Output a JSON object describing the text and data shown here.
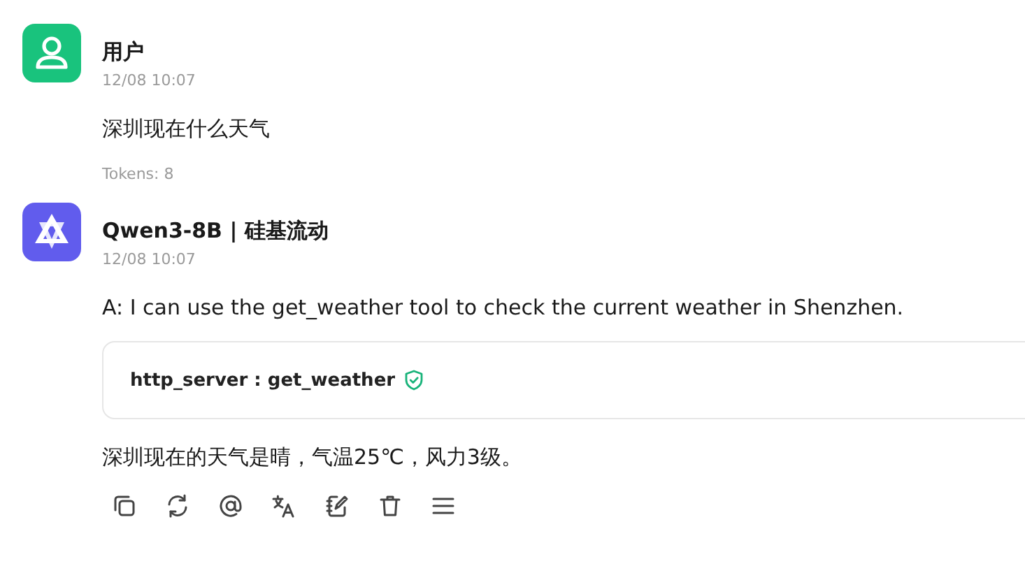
{
  "messages": [
    {
      "kind": "user",
      "name": "用户",
      "time": "12/08 10:07",
      "blocks": [
        {
          "kind": "text",
          "text": "深圳现在什么天气"
        }
      ],
      "tokens": "Tokens: 8"
    },
    {
      "kind": "assistant",
      "name": "Qwen3-8B | 硅基流动",
      "time": "12/08 10:07",
      "blocks": [
        {
          "kind": "text",
          "text": "A: I can use the get_weather tool to check the current weather in Shenzhen."
        },
        {
          "kind": "tool",
          "label": "http_server : get_weather",
          "verified": true
        },
        {
          "kind": "text",
          "text": "深圳现在的天气是晴，气温25℃，风力3级。"
        }
      ]
    }
  ]
}
